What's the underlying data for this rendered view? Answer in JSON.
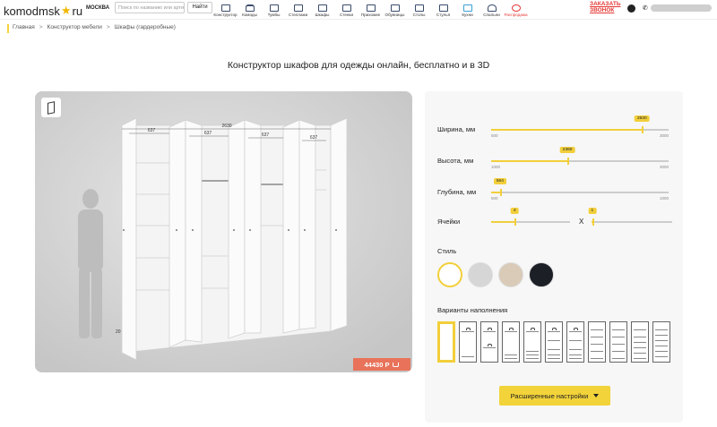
{
  "header": {
    "logo": {
      "left": "komodmsk",
      "right": "ru"
    },
    "city": "МОСКВА",
    "search": {
      "placeholder": "Поиск по названию или артикулу"
    },
    "find_label": "Найти",
    "nav": [
      {
        "label": "Конструктор",
        "icon": "constructor-icon"
      },
      {
        "label": "Комоды",
        "icon": "dresser-icon"
      },
      {
        "label": "Тумбы",
        "icon": "nightstand-icon"
      },
      {
        "label": "Стеллажи",
        "icon": "shelf-icon"
      },
      {
        "label": "Шкафы",
        "icon": "wardrobe-icon"
      },
      {
        "label": "Стенки",
        "icon": "wall-unit-icon"
      },
      {
        "label": "Прихожие",
        "icon": "hallway-icon"
      },
      {
        "label": "Обувницы",
        "icon": "shoe-rack-icon"
      },
      {
        "label": "Столы",
        "icon": "table-icon"
      },
      {
        "label": "Стулья",
        "icon": "chair-icon"
      },
      {
        "label": "Кухни",
        "icon": "kitchen-icon"
      },
      {
        "label": "Спальни",
        "icon": "bedroom-icon"
      },
      {
        "label": "Распродажа",
        "icon": "sale-icon"
      }
    ],
    "order_call": [
      "ЗАКАЗАТЬ",
      "ЗВОНОК"
    ]
  },
  "breadcrumbs": [
    "Главная",
    "Конструктор мебели",
    "Шкафы (гардеробные)"
  ],
  "page_title": "Конструктор шкафов для одежды онлайн, бесплатно и в 3D",
  "viewer": {
    "dimensions": {
      "total": "2630",
      "sections": [
        "637",
        "637",
        "637",
        "637"
      ],
      "bottom": "20"
    },
    "price": "44430 Р"
  },
  "panel": {
    "sliders": [
      {
        "label": "Ширина, мм",
        "value": "2630",
        "min": "500",
        "max": "3000",
        "fraction": 0.85
      },
      {
        "label": "Высота, мм",
        "value": "2360",
        "min": "1000",
        "max": "3000",
        "fraction": 0.43
      },
      {
        "label": "Глубина, мм",
        "value": "564",
        "min": "500",
        "max": "1000",
        "fraction": 0.05
      }
    ],
    "cells": {
      "label": "Ячейки",
      "cols": "4",
      "rows": "1",
      "x": "X",
      "cols_fraction": 0.3,
      "rows_fraction": 0.01
    },
    "style_label": "Стиль",
    "styles": [
      {
        "color": "#ffffff",
        "selected": true
      },
      {
        "color": "#d6d6d6"
      },
      {
        "color": "#d9cbb8"
      },
      {
        "color": "#1c1f26"
      }
    ],
    "fillings_label": "Варианты наполнения",
    "advanced_label": "Расширенные настройки"
  },
  "colors": {
    "accent": "#f2cf3a",
    "price": "#e8735a",
    "call": "#e53935"
  }
}
